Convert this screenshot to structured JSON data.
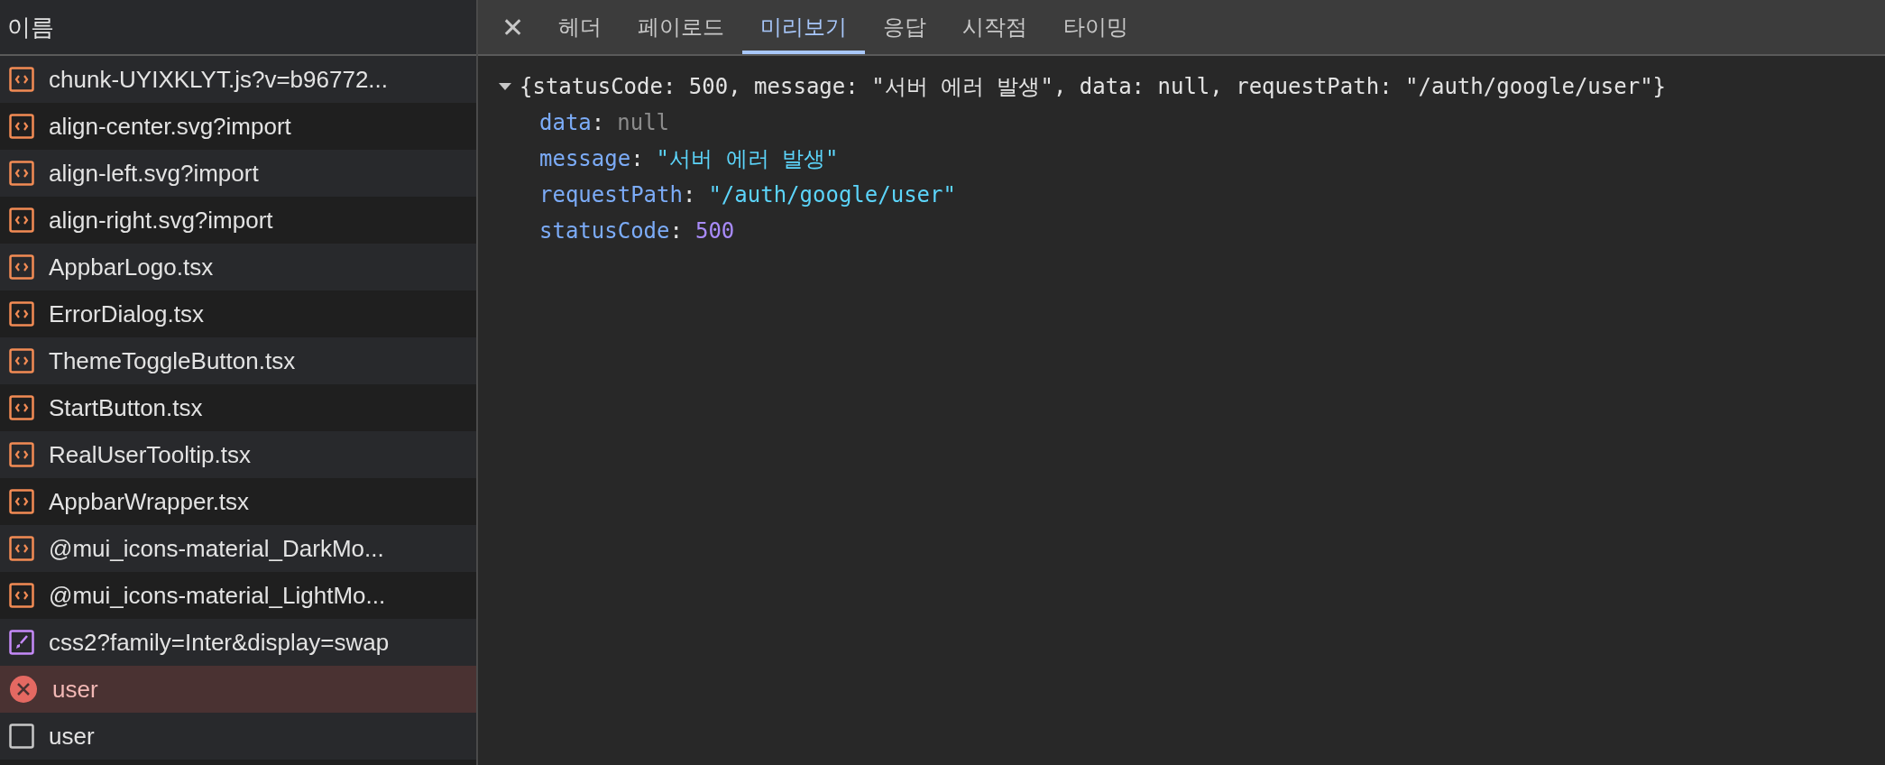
{
  "requests": {
    "column": "이름",
    "rows": [
      {
        "name": "chunk-UYIXKLYT.js?v=b96772...",
        "kind": "script",
        "error": false
      },
      {
        "name": "align-center.svg?import",
        "kind": "script",
        "error": false
      },
      {
        "name": "align-left.svg?import",
        "kind": "script",
        "error": false
      },
      {
        "name": "align-right.svg?import",
        "kind": "script",
        "error": false
      },
      {
        "name": "AppbarLogo.tsx",
        "kind": "script",
        "error": false
      },
      {
        "name": "ErrorDialog.tsx",
        "kind": "script",
        "error": false
      },
      {
        "name": "ThemeToggleButton.tsx",
        "kind": "script",
        "error": false
      },
      {
        "name": "StartButton.tsx",
        "kind": "script",
        "error": false
      },
      {
        "name": "RealUserTooltip.tsx",
        "kind": "script",
        "error": false
      },
      {
        "name": "AppbarWrapper.tsx",
        "kind": "script",
        "error": false
      },
      {
        "name": "@mui_icons-material_DarkMo...",
        "kind": "script",
        "error": false
      },
      {
        "name": "@mui_icons-material_LightMo...",
        "kind": "script",
        "error": false
      },
      {
        "name": "css2?family=Inter&display=swap",
        "kind": "stylesheet",
        "error": false
      },
      {
        "name": "user",
        "kind": "fetch",
        "error": true
      },
      {
        "name": "user",
        "kind": "document",
        "error": false
      }
    ]
  },
  "details": {
    "close": "✕",
    "tabs": [
      {
        "label": "헤더",
        "selected": false
      },
      {
        "label": "페이로드",
        "selected": false
      },
      {
        "label": "미리보기",
        "selected": true
      },
      {
        "label": "응답",
        "selected": false
      },
      {
        "label": "시작점",
        "selected": false
      },
      {
        "label": "타이밍",
        "selected": false
      }
    ],
    "preview": {
      "expanded": true,
      "summary": "{statusCode: 500, message: \"서버 에러 발생\", data: null, requestPath: \"/auth/google/user\"}",
      "properties": [
        {
          "key": "data",
          "separator": ":",
          "value": "null",
          "kind": "null"
        },
        {
          "key": "message",
          "separator": ":",
          "value": "\"서버 에러 발생\"",
          "kind": "string"
        },
        {
          "key": "requestPath",
          "separator": ":",
          "value": "\"/auth/google/user\"",
          "kind": "string"
        },
        {
          "key": "statusCode",
          "separator": ":",
          "value": "500",
          "kind": "number"
        }
      ]
    }
  }
}
